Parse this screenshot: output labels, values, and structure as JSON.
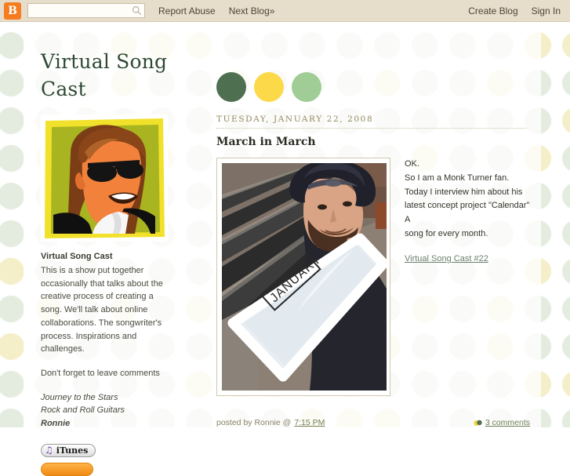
{
  "navbar": {
    "logo_letter": "B",
    "search_placeholder": "",
    "search_value": "",
    "search_icon": "search-icon",
    "links_left": [
      "Report Abuse",
      "Next Blog»"
    ],
    "links_right": [
      "Create Blog",
      "Sign In"
    ],
    "background_color": "#e6ddcb"
  },
  "header": {
    "blog_title": "Virtual Song Cast",
    "dots": [
      {
        "name": "dark-green",
        "color": "#4f7050"
      },
      {
        "name": "yellow",
        "color": "#fcd949"
      },
      {
        "name": "light-green",
        "color": "#a0cc96"
      }
    ]
  },
  "sidebar": {
    "avatar_alt": "cartoon-avatar-man-with-sunglasses",
    "profile_name": "Virtual Song Cast",
    "profile_description": "This is a show put together occasionally that talks about the creative process of creating a song. We'll talk about online collaborations. The songwriter's process. Inspirations and challenges.",
    "profile_note": "Don't forget to leave comments",
    "credits": [
      "Journey to the Stars",
      "Rock and Roll Guitars"
    ],
    "credits_owner": "Ronnie",
    "itunes_label": "iTunes",
    "itunes_icon": "music-note-icon",
    "feed_badge_name": "rss-feed-badge"
  },
  "post": {
    "date": "TUESDAY, JANUARY 22, 2008",
    "title": "March in March",
    "photo_alt": "man-in-cowboy-hat-holding-whiteboard-labeled-JANUARY",
    "body_lines": [
      "OK.",
      "So I am a Monk Turner fan.",
      "Today I interview him about his",
      "latest concept project \"Calendar\" A",
      "song for every month."
    ],
    "link_text": "Virtual Song Cast #22",
    "posted_by_prefix": "posted by Ronnie @",
    "posted_time": "7:15 PM",
    "comments_text": "3 comments",
    "comments_icon": "comment-bubbles-icon"
  },
  "theme": {
    "page_background": "#ffffff",
    "dot_green": "#e4ecdf",
    "dot_yellow": "#f4efc8",
    "title_color": "#2f4a33",
    "date_color": "#93875f",
    "link_color": "#6b7f70"
  }
}
